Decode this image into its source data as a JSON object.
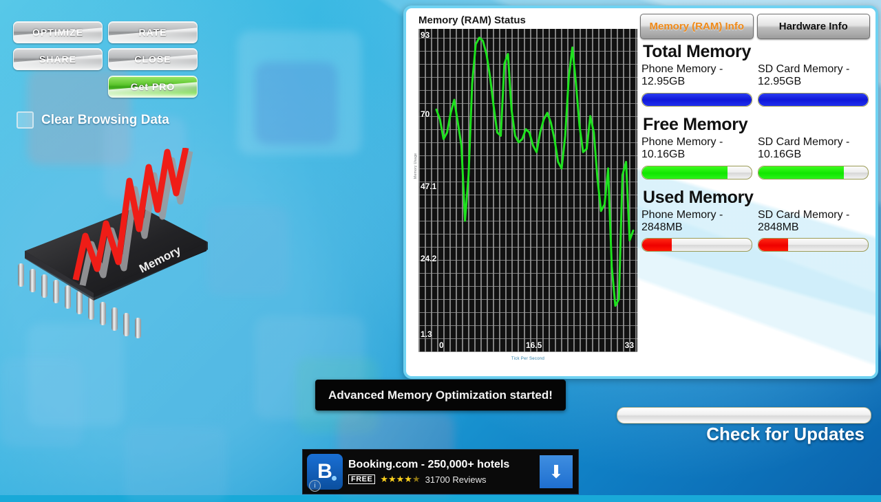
{
  "left_panel": {
    "buttons": [
      {
        "label": "OPTIMIZE",
        "name": "optimize-button"
      },
      {
        "label": "RATE",
        "name": "rate-button"
      },
      {
        "label": "SHARE",
        "name": "share-button"
      },
      {
        "label": "CLOSE",
        "name": "close-button"
      },
      {
        "label": "Get PRO",
        "name": "get-pro-button"
      }
    ],
    "optimize_label": "OPTIMIZE",
    "rate_label": "RATE",
    "share_label": "SHARE",
    "close_label": "CLOSE",
    "get_pro_label": "Get PRO",
    "clear_browsing_label": "Clear Browsing Data",
    "clear_browsing_checked": false,
    "chip_label": "Memory"
  },
  "panel": {
    "tabs": [
      {
        "label": "Memory (RAM) Info",
        "active": true
      },
      {
        "label": "Hardware Info",
        "active": false
      }
    ],
    "tab_memory_label": "Memory (RAM) Info",
    "tab_hardware_label": "Hardware Info",
    "active_tab_color": "#f08a19",
    "sections": [
      {
        "title": "Total Memory",
        "bar_color": "#1218d8",
        "items": [
          {
            "label": "Phone Memory - 12.95GB",
            "percent": 100
          },
          {
            "label": "SD Card Memory - 12.95GB",
            "percent": 100
          }
        ]
      },
      {
        "title": "Free Memory",
        "bar_color": "#11e600",
        "items": [
          {
            "label": "Phone Memory - 10.16GB",
            "percent": 78
          },
          {
            "label": "SD Card Memory - 10.16GB",
            "percent": 78
          }
        ]
      },
      {
        "title": "Used Memory",
        "bar_color": "#ef0000",
        "items": [
          {
            "label": "Phone Memory - 2848MB",
            "percent": 27
          },
          {
            "label": "SD Card Memory - 2848MB",
            "percent": 27
          }
        ]
      }
    ],
    "total_title": "Total Memory",
    "total_phone": "Phone Memory - 12.95GB",
    "total_sd": "SD Card Memory - 12.95GB",
    "free_title": "Free Memory",
    "free_phone": "Phone Memory - 10.16GB",
    "free_sd": "SD Card Memory - 10.16GB",
    "used_title": "Used Memory",
    "used_phone": "Phone Memory - 2848MB",
    "used_sd": "SD Card Memory - 2848MB"
  },
  "chart_data": {
    "type": "line",
    "title": "Memory (RAM) Status",
    "xlabel": "Tick Per Second",
    "ylabel": "Memory Usage",
    "grid": true,
    "legend": false,
    "line_color": "#1ee31e",
    "background": "#111111",
    "xlim": [
      0,
      33
    ],
    "ylim": [
      1.3,
      93
    ],
    "xticks": [
      "0",
      "16.5",
      "33"
    ],
    "yticks": [
      "93",
      "70",
      "47.1",
      "24.2",
      "1.3"
    ],
    "x": [
      0,
      0.6,
      1.2,
      1.8,
      2.4,
      3.0,
      3.6,
      4.2,
      4.8,
      5.4,
      6.0,
      6.6,
      7.2,
      7.8,
      8.4,
      9.0,
      9.6,
      10.2,
      10.8,
      11.4,
      12.0,
      12.6,
      13.2,
      13.8,
      14.4,
      15.0,
      15.6,
      16.2,
      16.8,
      17.4,
      18.0,
      18.6,
      19.2,
      19.8,
      20.4,
      21.0,
      21.6,
      22.2,
      22.8,
      23.4,
      24.0,
      24.6,
      25.2,
      25.8,
      26.4,
      27.0,
      27.6,
      28.2,
      28.8,
      29.4,
      30.0,
      30.6,
      31.2,
      31.8,
      32.4,
      33
    ],
    "y": [
      70,
      67,
      61,
      63,
      69,
      73,
      66,
      59,
      36,
      50,
      78,
      90,
      92,
      91,
      87,
      80,
      71,
      63,
      62,
      84,
      87,
      70,
      62,
      60,
      61,
      64,
      63,
      59,
      57,
      63,
      67,
      69,
      66,
      61,
      54,
      52,
      62,
      80,
      89,
      78,
      65,
      57,
      58,
      68,
      63,
      49,
      39,
      41,
      52,
      22,
      10,
      12,
      50,
      54,
      30,
      33
    ]
  },
  "toast": {
    "message": "Advanced Memory Optimization started!"
  },
  "updates": {
    "label": "Check for Updates"
  },
  "ad": {
    "icon_letter": "B",
    "info_glyph": "i",
    "title": "Booking.com - 250,000+ hotels",
    "free_badge": "FREE",
    "stars": "★★★★",
    "half_star": "★",
    "reviews": "31700 Reviews",
    "download_glyph": "⬇"
  }
}
